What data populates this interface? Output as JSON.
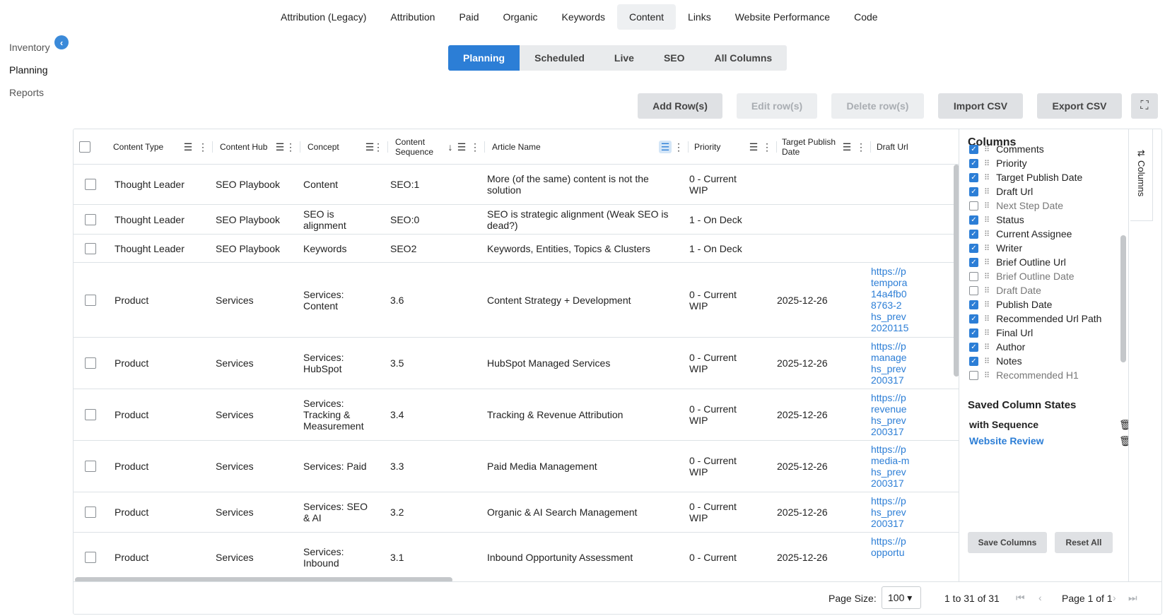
{
  "topnav": {
    "tabs": [
      "Attribution (Legacy)",
      "Attribution",
      "Paid",
      "Organic",
      "Keywords",
      "Content",
      "Links",
      "Website Performance",
      "Code"
    ],
    "active": "Content"
  },
  "sidenav": {
    "items": [
      "Inventory",
      "Planning",
      "Reports"
    ],
    "active": "Planning",
    "collapse_icon": "chevron-left-icon"
  },
  "subtabs": {
    "items": [
      "Planning",
      "Scheduled",
      "Live",
      "SEO",
      "All Columns"
    ],
    "active": "Planning"
  },
  "actions": {
    "add": "Add Row(s)",
    "edit": "Edit row(s)",
    "delete": "Delete row(s)",
    "import": "Import CSV",
    "export": "Export CSV"
  },
  "columns": {
    "content_type": "Content Type",
    "content_hub": "Content Hub",
    "concept": "Concept",
    "content_sequence": [
      "Content",
      "Sequence"
    ],
    "article_name": "Article Name",
    "priority": "Priority",
    "target_publish_date": [
      "Target Publish",
      "Date"
    ],
    "draft_url": "Draft Url"
  },
  "rows": [
    {
      "type": "Thought Leader",
      "hub": "SEO Playbook",
      "concept": [
        "Content"
      ],
      "seq": "SEO:1",
      "article": [
        "More (of the same) content is not the",
        "solution"
      ],
      "priority": [
        "0 - Current",
        "WIP"
      ],
      "date": "",
      "url": ""
    },
    {
      "type": "Thought Leader",
      "hub": "SEO Playbook",
      "concept": [
        "SEO is",
        "alignment"
      ],
      "seq": "SEO:0",
      "article": [
        "SEO is strategic alignment (Weak SEO is",
        "dead?)"
      ],
      "priority": [
        "1 - On Deck"
      ],
      "date": "",
      "url": ""
    },
    {
      "type": "Thought Leader",
      "hub": "SEO Playbook",
      "concept": [
        "Keywords"
      ],
      "seq": "SEO2",
      "article": [
        "Keywords, Entities, Topics & Clusters"
      ],
      "priority": [
        "1 - On Deck"
      ],
      "date": "",
      "url": ""
    },
    {
      "type": "Product",
      "hub": "Services",
      "concept": [
        "Services:",
        "Content"
      ],
      "seq": "3.6",
      "article": [
        "Content Strategy + Development"
      ],
      "priority": [
        "0 - Current",
        "WIP"
      ],
      "date": "2025-12-26",
      "url": "https://p\ntempora\n14a4fb0\n8763-2\nhs_prev\n2020115"
    },
    {
      "type": "Product",
      "hub": "Services",
      "concept": [
        "Services:",
        "HubSpot"
      ],
      "seq": "3.5",
      "article": [
        "HubSpot Managed Services"
      ],
      "priority": [
        "0 - Current",
        "WIP"
      ],
      "date": "2025-12-26",
      "url": "https://p\nmanage\nhs_prev\n200317"
    },
    {
      "type": "Product",
      "hub": "Services",
      "concept": [
        "Services:",
        "Tracking &",
        "Measurement"
      ],
      "seq": "3.4",
      "article": [
        "Tracking & Revenue Attribution"
      ],
      "priority": [
        "0 - Current",
        "WIP"
      ],
      "date": "2025-12-26",
      "url": "https://p\nrevenue\nhs_prev\n200317"
    },
    {
      "type": "Product",
      "hub": "Services",
      "concept": [
        "Services: Paid"
      ],
      "seq": "3.3",
      "article": [
        "Paid Media Management"
      ],
      "priority": [
        "0 - Current",
        "WIP"
      ],
      "date": "2025-12-26",
      "url": "https://p\nmedia-m\nhs_prev\n200317"
    },
    {
      "type": "Product",
      "hub": "Services",
      "concept": [
        "Services: SEO",
        "& AI"
      ],
      "seq": "3.2",
      "article": [
        "Organic & AI Search Management"
      ],
      "priority": [
        "0 - Current",
        "WIP"
      ],
      "date": "2025-12-26",
      "url": "https://p\nhs_prev\n200317"
    },
    {
      "type": "Product",
      "hub": "Services",
      "concept": [
        "Services:",
        "Inbound"
      ],
      "seq": "3.1",
      "article": [
        "Inbound Opportunity Assessment"
      ],
      "priority": [
        "0 - Current"
      ],
      "date": "2025-12-26",
      "url": "https://p\nopportu"
    }
  ],
  "column_panel": {
    "title": "Columns",
    "items": [
      {
        "label": "Comments",
        "checked": true
      },
      {
        "label": "Priority",
        "checked": true
      },
      {
        "label": "Target Publish Date",
        "checked": true
      },
      {
        "label": "Draft Url",
        "checked": true
      },
      {
        "label": "Next Step Date",
        "checked": false
      },
      {
        "label": "Status",
        "checked": true
      },
      {
        "label": "Current Assignee",
        "checked": true
      },
      {
        "label": "Writer",
        "checked": true
      },
      {
        "label": "Brief Outline Url",
        "checked": true
      },
      {
        "label": "Brief Outline Date",
        "checked": false
      },
      {
        "label": "Draft Date",
        "checked": false
      },
      {
        "label": "Publish Date",
        "checked": true
      },
      {
        "label": "Recommended Url Path",
        "checked": true
      },
      {
        "label": "Final Url",
        "checked": true
      },
      {
        "label": "Author",
        "checked": true
      },
      {
        "label": "Notes",
        "checked": true
      },
      {
        "label": "Recommended H1",
        "checked": false
      }
    ],
    "saved_title": "Saved Column States",
    "saved": [
      "with Sequence",
      "Website Review"
    ],
    "save_btn": "Save Columns",
    "reset_btn": "Reset All",
    "side_tab": "Columns"
  },
  "footer": {
    "page_size_label": "Page Size:",
    "page_size": "100",
    "range": "1 to 31 of 31",
    "page": "Page 1 of 1"
  },
  "colors": {
    "accent": "#2c7ed6",
    "link": "#2c7ed6"
  }
}
